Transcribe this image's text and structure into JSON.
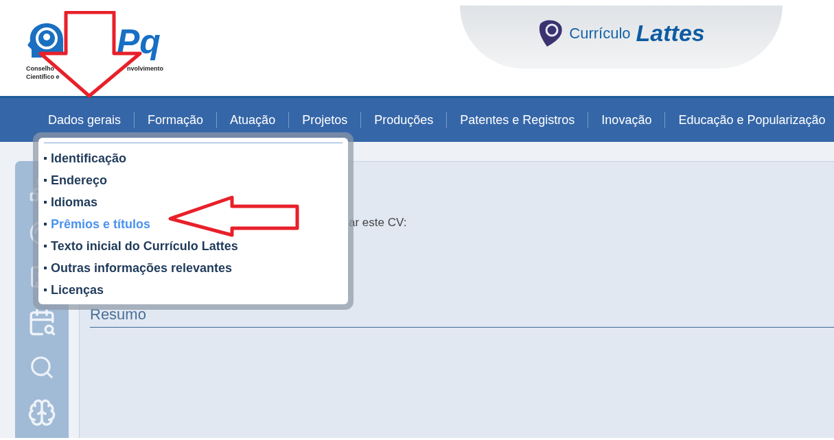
{
  "header": {
    "logo_text": "Pq",
    "logo_caption": [
      [
        "Conselho",
        "nvolvimento"
      ],
      [
        "Científico e"
      ]
    ],
    "product": {
      "prefix": "Currículo",
      "name": "Lattes"
    }
  },
  "nav": [
    "Dados gerais",
    "Formação",
    "Atuação",
    "Projetos",
    "Produções",
    "Patentes e Registros",
    "Inovação",
    "Educação e Popularização"
  ],
  "dropdown": {
    "items": [
      {
        "label": "Identificação",
        "selected": false
      },
      {
        "label": "Endereço",
        "selected": false
      },
      {
        "label": "Idiomas",
        "selected": false
      },
      {
        "label": "Prêmios e títulos",
        "selected": true
      },
      {
        "label": "Texto inicial do Currículo Lattes",
        "selected": false
      },
      {
        "label": "Outras informações relevantes",
        "selected": false
      },
      {
        "label": "Licenças",
        "selected": false
      }
    ]
  },
  "content": {
    "partial_text": "ar este CV:",
    "section_title": "Resumo"
  }
}
